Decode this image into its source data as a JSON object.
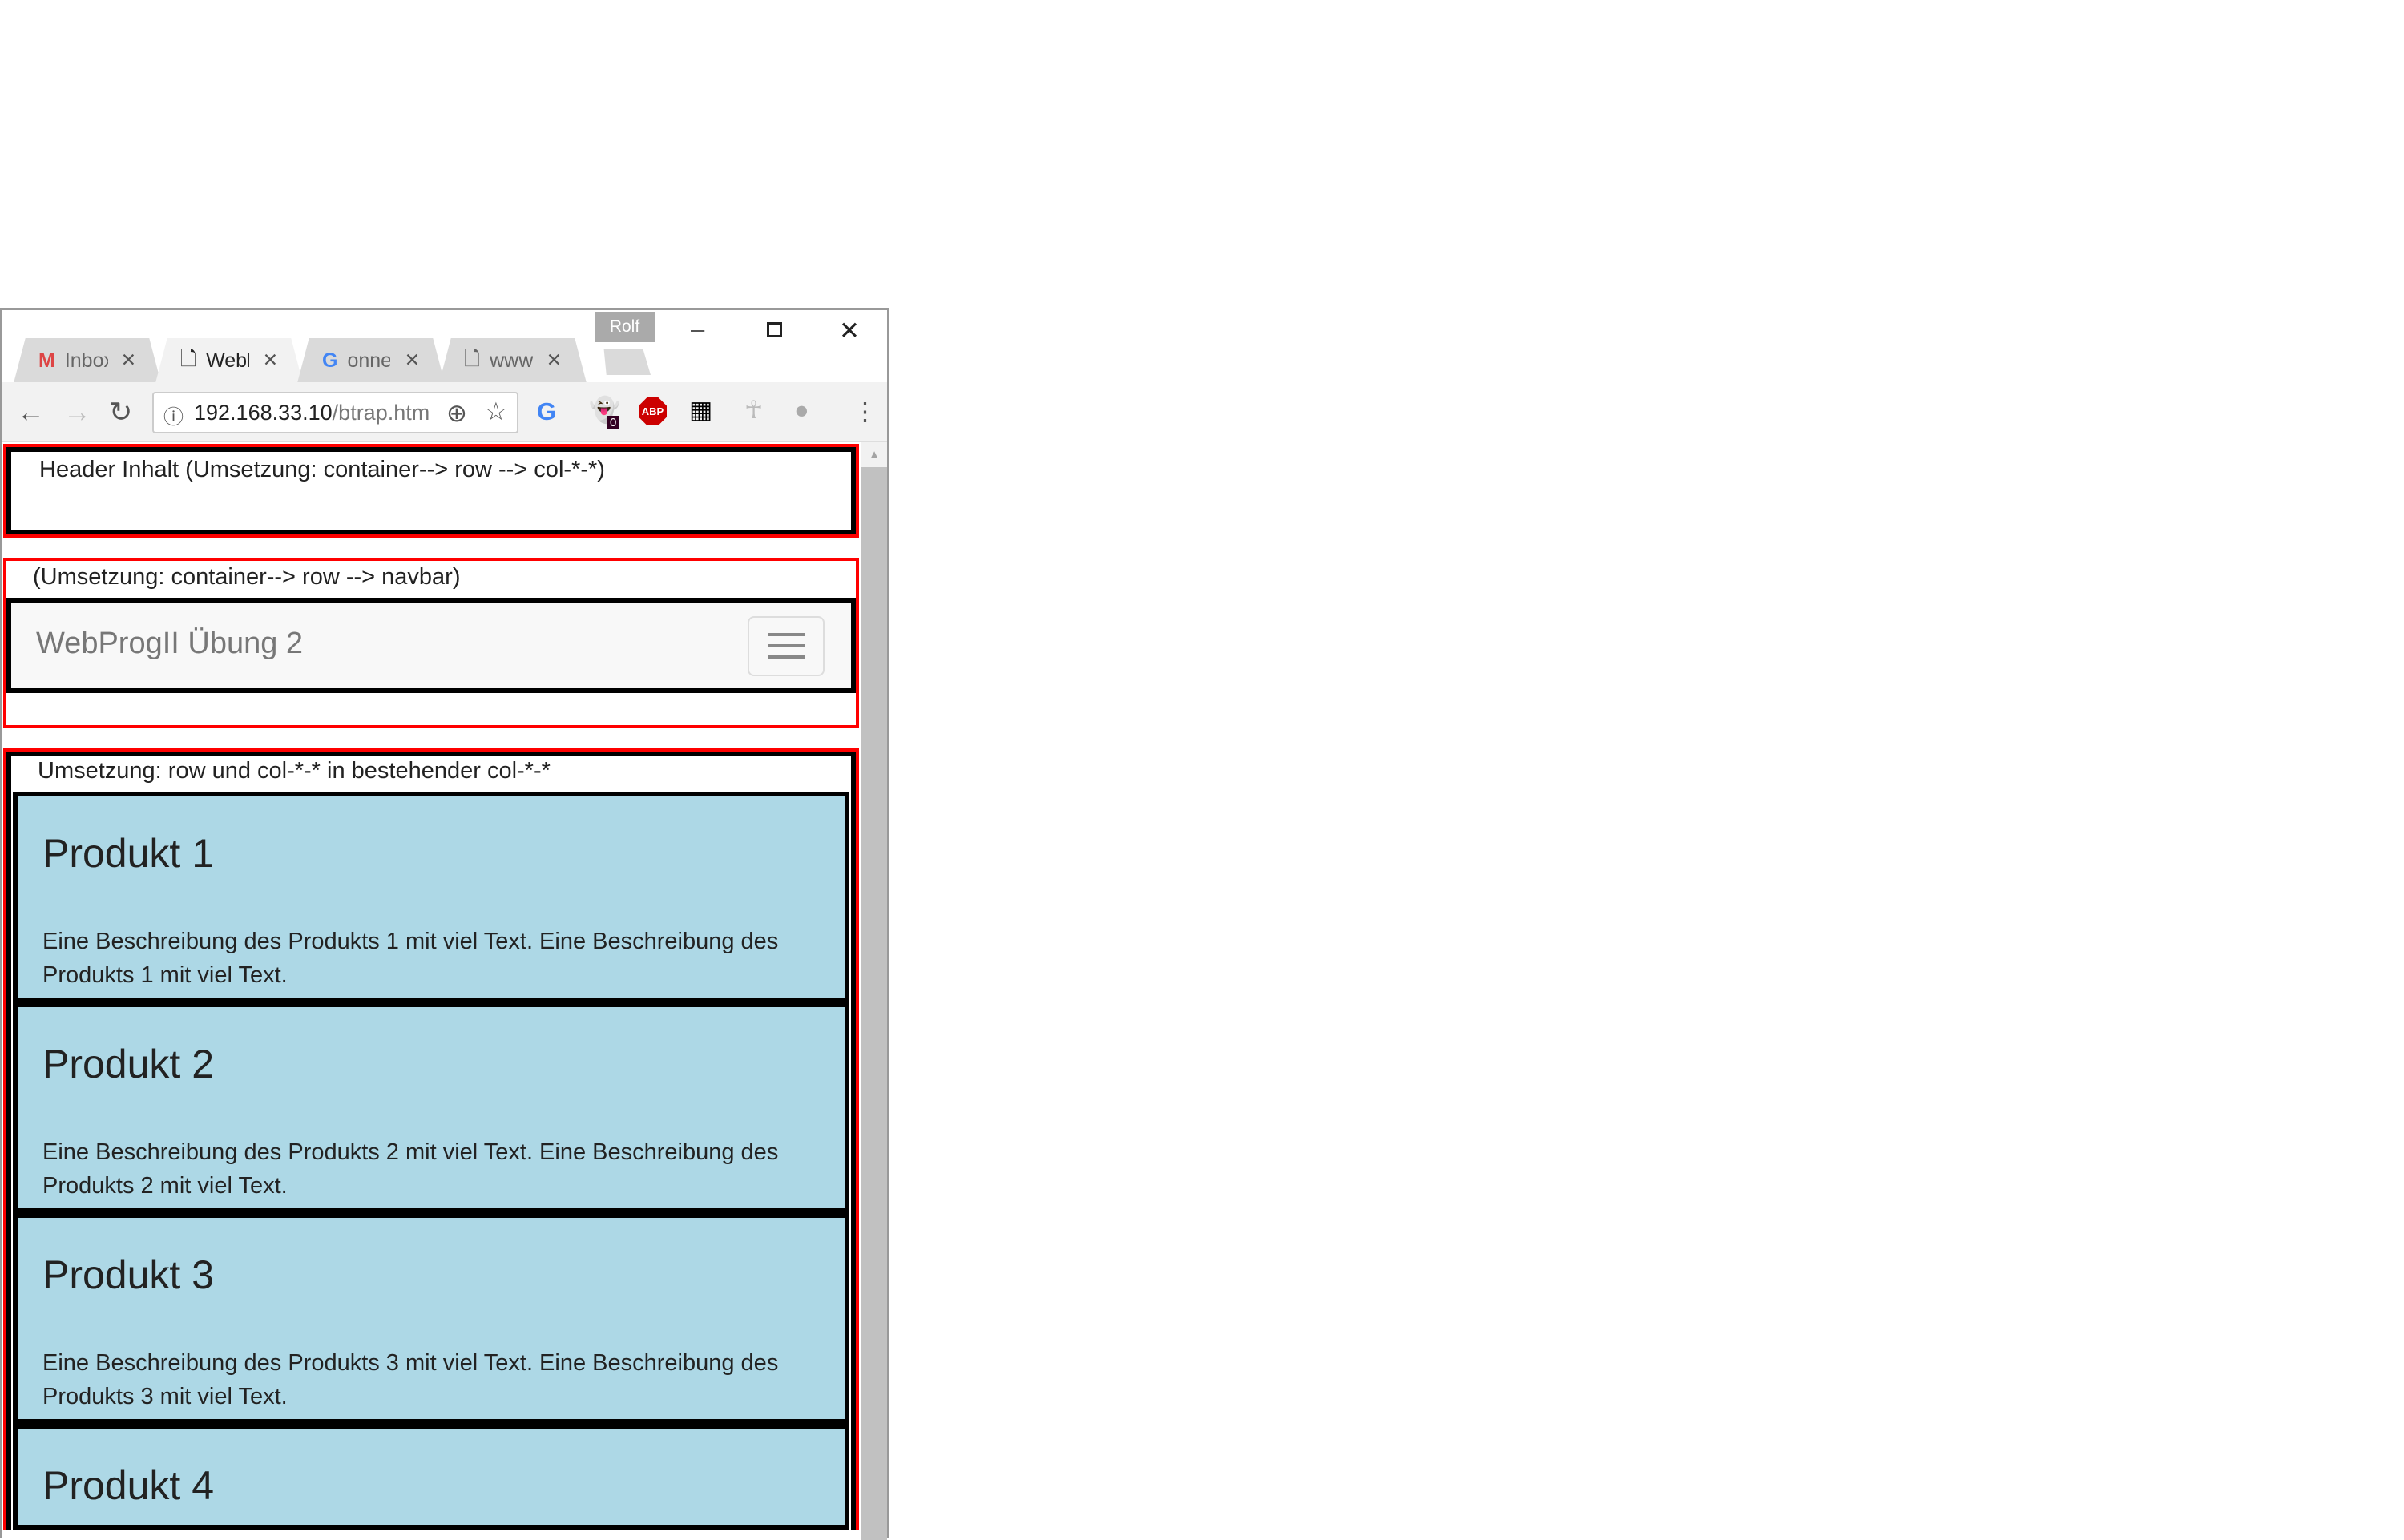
{
  "browser": {
    "profile": "Rolf",
    "tabs": [
      {
        "title": "Inbox",
        "icon": "gmail-icon"
      },
      {
        "title": "WebP",
        "icon": "page-icon",
        "active": true
      },
      {
        "title": "onne",
        "icon": "google-icon"
      },
      {
        "title": "www.",
        "icon": "page-icon"
      }
    ],
    "url_host": "192.168.33.10",
    "url_path": "/btrap.htm",
    "extension_badge": "0",
    "abp_label": "ABP"
  },
  "page": {
    "header_text": "Header Inhalt (Umsetzung: container--> row --> col-*-*)",
    "nav_caption": "(Umsetzung: container--> row --> navbar)",
    "brand": "WebProgII Übung 2",
    "section_caption": "Umsetzung: row und col-*-* in bestehender col-*-*",
    "products": [
      {
        "title": "Produkt 1",
        "desc": "Eine Beschreibung des Produkts 1 mit viel Text. Eine Beschreibung des Produkts 1 mit viel Text."
      },
      {
        "title": "Produkt 2",
        "desc": "Eine Beschreibung des Produkts 2 mit viel Text. Eine Beschreibung des Produkts 2 mit viel Text."
      },
      {
        "title": "Produkt 3",
        "desc": "Eine Beschreibung des Produkts 3 mit viel Text. Eine Beschreibung des Produkts 3 mit viel Text."
      },
      {
        "title": "Produkt 4",
        "desc": ""
      }
    ]
  }
}
